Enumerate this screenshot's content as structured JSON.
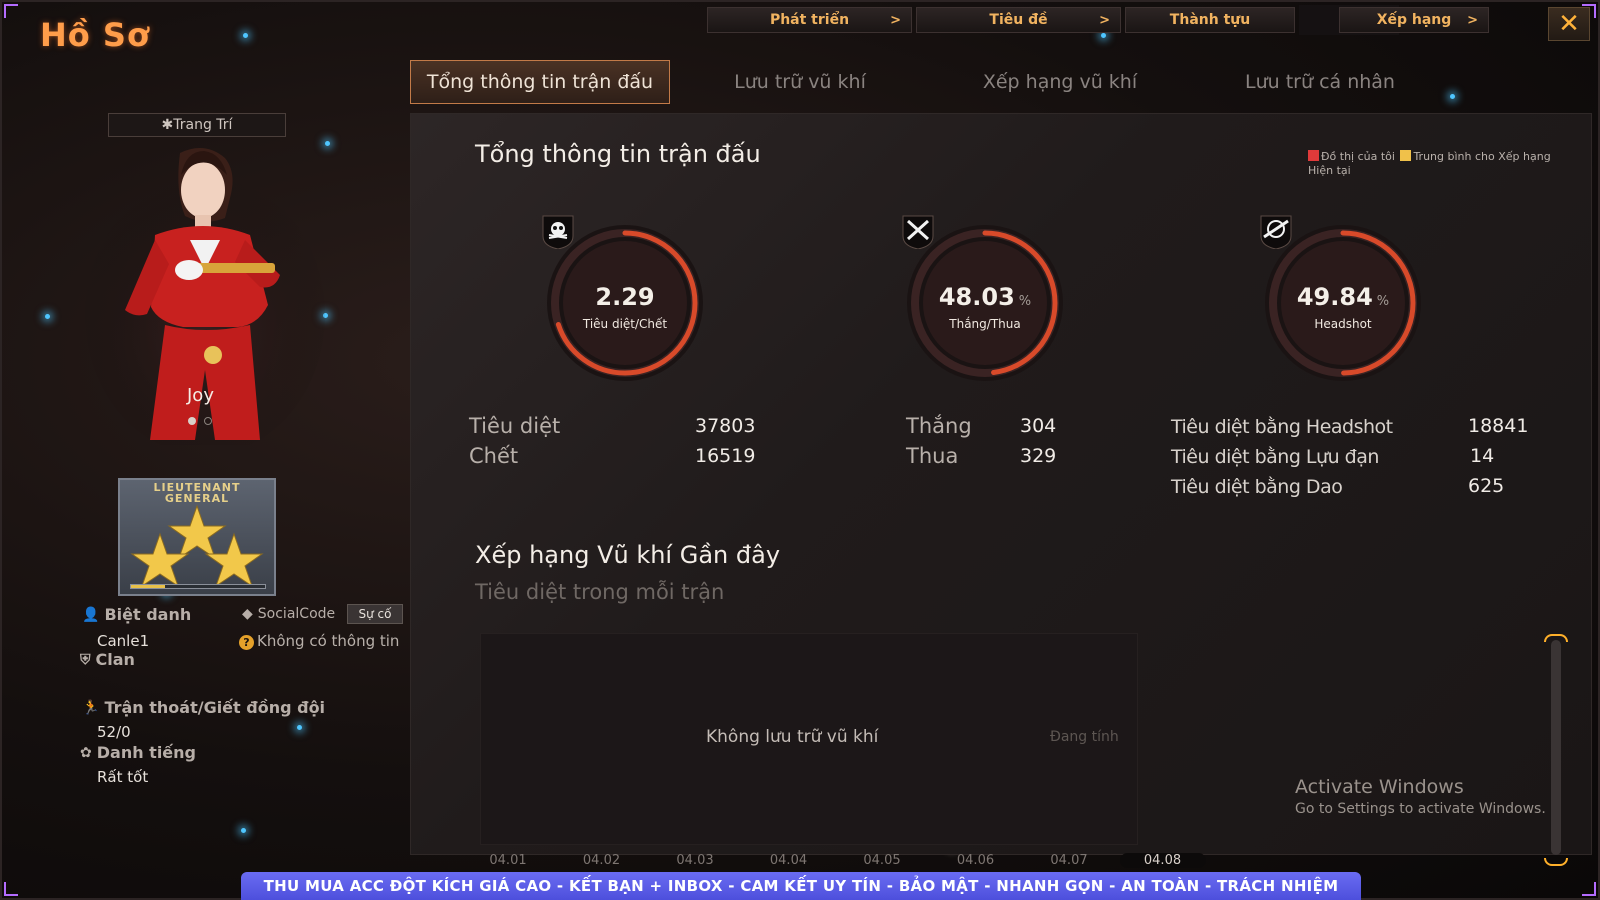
{
  "page": {
    "title": "Hồ Sơ"
  },
  "topnav": [
    {
      "label": "Phát triển",
      "chevron": ">"
    },
    {
      "label": "Tiêu đề",
      "chevron": ">"
    },
    {
      "label": "Thành tựu",
      "chevron": ""
    },
    {
      "label": "Xếp hạng",
      "chevron": ">"
    }
  ],
  "close": {
    "label": "✕"
  },
  "tabs": [
    {
      "label": "Tổng thông tin trận đấu",
      "active": true
    },
    {
      "label": "Lưu trữ vũ khí",
      "active": false
    },
    {
      "label": "Xếp hạng vũ khí",
      "active": false
    },
    {
      "label": "Lưu trữ cá nhân",
      "active": false
    }
  ],
  "profile": {
    "decor_button": "✱Trang Trí",
    "character_name": "Joy",
    "rank_badge_text": "LIEUTENANT GENERAL",
    "rank_progress": 0.25,
    "nickname_label": "Biệt danh",
    "nickname_value": "Canle1",
    "socialcode_label": "SocialCode",
    "report_button": "Sự cố",
    "socialcode_value": "Không có thông tin",
    "clan_label": "Clan",
    "escape_label": "Trận thoát/Giết đồng đội",
    "escape_value": "52/0",
    "reputation_label": "Danh tiếng",
    "reputation_value": "Rất tốt"
  },
  "summary": {
    "title": "Tổng thông tin trận đấu",
    "legend": {
      "mine": "Đồ thị của tôi",
      "average": "Trung bình cho Xếp hạng Hiện tại",
      "mine_color": "#e03a3a",
      "average_color": "#f0c14a"
    },
    "gauges": [
      {
        "value": "2.29",
        "unit": "",
        "label": "Tiêu diệt/Chết",
        "icon": "skull-icon",
        "fill": 0.7
      },
      {
        "value": "48.03",
        "unit": "%",
        "label": "Thắng/Thua",
        "icon": "crossed-swords-icon",
        "fill": 0.4803
      },
      {
        "value": "49.84",
        "unit": "%",
        "label": "Headshot",
        "icon": "crosshair-rifle-icon",
        "fill": 0.4984
      }
    ],
    "stats": {
      "kills_label": "Tiêu diệt",
      "kills_value": "37803",
      "deaths_label": "Chết",
      "deaths_value": "16519",
      "wins_label": "Thắng",
      "wins_value": "304",
      "losses_label": "Thua",
      "losses_value": "329",
      "headshot_kills_label": "Tiêu diệt bằng Headshot",
      "headshot_kills_value": "18841",
      "grenade_kills_label": "Tiêu diệt bằng Lựu đạn",
      "grenade_kills_value": "14",
      "knife_kills_label": "Tiêu diệt bằng Dao",
      "knife_kills_value": "625"
    }
  },
  "recent": {
    "title": "Xếp hạng Vũ khí Gần đây",
    "subtitle": "Tiêu diệt trong mỗi trận",
    "empty": "Không lưu trữ vũ khí",
    "calculating": "Đang tính",
    "dates": [
      "04.01",
      "04.02",
      "04.03",
      "04.04",
      "04.05",
      "04.06",
      "04.07",
      "04.08"
    ],
    "selected_date": "04.08"
  },
  "watermark": {
    "title": "Activate Windows",
    "subtitle": "Go to Settings to activate Windows."
  },
  "banner": "THU MUA ACC ĐỘT KÍCH GIÁ CAO  -  KẾT BẠN + INBOX  -  CAM KẾT UY TÍN - BẢO MẬT - NHANH GỌN - AN TOÀN - TRÁCH NHIỆM"
}
